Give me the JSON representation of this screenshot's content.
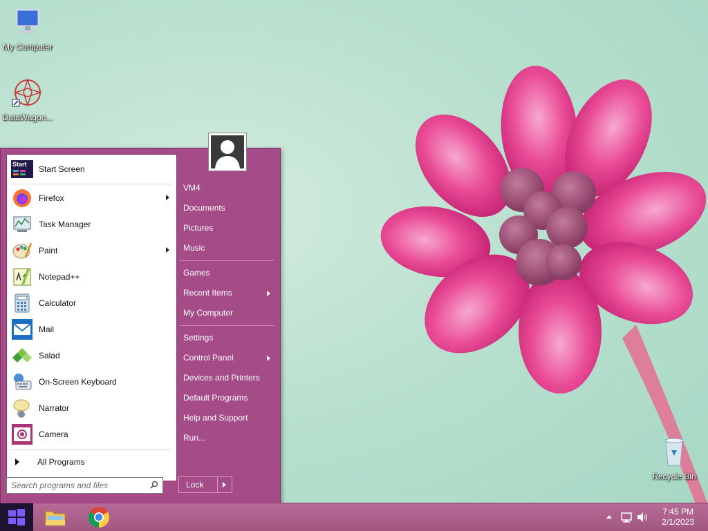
{
  "desktop": {
    "icons": [
      {
        "label": "My Computer"
      },
      {
        "label": "DataWagon..."
      },
      {
        "label": "Recycle Bin"
      }
    ]
  },
  "start_menu": {
    "pinned": [
      {
        "label": "Start Screen",
        "icon": "start-screen-icon"
      },
      {
        "label": "Firefox",
        "icon": "firefox-icon",
        "submenu": true
      },
      {
        "label": "Task Manager",
        "icon": "task-manager-icon"
      },
      {
        "label": "Paint",
        "icon": "paint-icon",
        "submenu": true
      },
      {
        "label": "Notepad++",
        "icon": "notepadpp-icon"
      },
      {
        "label": "Calculator",
        "icon": "calculator-icon"
      },
      {
        "label": "Mail",
        "icon": "mail-icon"
      },
      {
        "label": "Salad",
        "icon": "salad-icon"
      },
      {
        "label": "On-Screen Keyboard",
        "icon": "keyboard-icon"
      },
      {
        "label": "Narrator",
        "icon": "narrator-icon"
      },
      {
        "label": "Camera",
        "icon": "camera-icon"
      }
    ],
    "start_screen_badge": "Start",
    "all_programs": "All Programs",
    "search_placeholder": "Search programs and files",
    "right": [
      {
        "label": "VM4"
      },
      {
        "label": "Documents"
      },
      {
        "label": "Pictures"
      },
      {
        "label": "Music"
      },
      {
        "label": "Games"
      },
      {
        "label": "Recent Items",
        "submenu": true
      },
      {
        "label": "My Computer"
      },
      {
        "label": "Settings"
      },
      {
        "label": "Control Panel",
        "submenu": true
      },
      {
        "label": "Devices and Printers"
      },
      {
        "label": "Default Programs"
      },
      {
        "label": "Help and Support"
      },
      {
        "label": "Run..."
      }
    ],
    "lock_label": "Lock"
  },
  "taskbar": {
    "clock_time": "7:45 PM",
    "clock_date": "2/1/2023"
  }
}
